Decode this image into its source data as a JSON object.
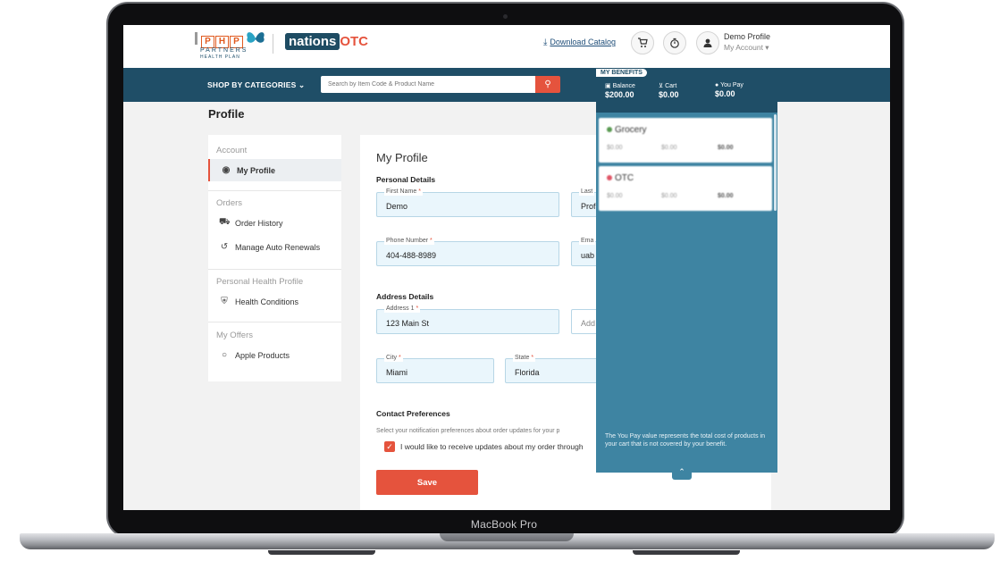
{
  "device": {
    "label": "MacBook Pro"
  },
  "header": {
    "brand_letters": [
      "P",
      "H",
      "P"
    ],
    "brand_line1": "PARTNERS",
    "brand_line2": "HEALTH PLAN",
    "partner_logo_a": "nations",
    "partner_logo_b": "OTC",
    "download_link": "Download Catalog",
    "profile_name": "Demo Profile",
    "profile_sub": "My Account ▾",
    "icons": [
      "download-icon",
      "cart-icon",
      "timer-icon",
      "user-icon"
    ]
  },
  "navbar": {
    "shop_label": "SHOP BY CATEGORIES ⌄",
    "search_placeholder": "Search by Item Code & Product Name"
  },
  "page": {
    "title": "Profile"
  },
  "sidebar": {
    "sections": [
      {
        "title": "Account",
        "items": [
          {
            "label": "My Profile",
            "icon": "user-circle-icon",
            "active": true
          }
        ]
      },
      {
        "title": "Orders",
        "items": [
          {
            "label": "Order History",
            "icon": "truck-icon"
          },
          {
            "label": "Manage Auto Renewals",
            "icon": "history-icon"
          }
        ]
      },
      {
        "title": "Personal Health Profile",
        "items": [
          {
            "label": "Health Conditions",
            "icon": "shield-icon"
          }
        ]
      },
      {
        "title": "My Offers",
        "items": [
          {
            "label": "Apple Products",
            "icon": "apple-icon"
          }
        ]
      }
    ]
  },
  "profile": {
    "heading": "My Profile",
    "personal_title": "Personal Details",
    "first_name_label": "First Name",
    "first_name": "Demo",
    "last_name_label": "Last",
    "last_name": "Prof",
    "phone_label": "Phone Number",
    "phone": "404-488-8989",
    "email_label": "Ema",
    "email": "uab",
    "address_title": "Address Details",
    "address1_label": "Address 1",
    "address1": "123 Main St",
    "address2_placeholder": "Add",
    "city_label": "City",
    "city": "Miami",
    "state_label": "State",
    "state": "Florida",
    "contact_title": "Contact Preferences",
    "contact_note": "Select your notification preferences about order updates for your p",
    "checkbox_label": "I would like to receive updates about my order through",
    "checkbox_checked": true,
    "save_label": "Save",
    "required_mark": "*"
  },
  "benefits": {
    "tag": "MY BENEFITS",
    "balance_label": "Balance",
    "balance": "$200.00",
    "cart_label": "Cart",
    "cart": "$0.00",
    "you_pay_label": "You Pay",
    "you_pay": "$0.00",
    "cards": [
      {
        "name": "Grocery",
        "dot_color": "#5a9a52",
        "balance": "$0.00",
        "cart": "$0.00",
        "you_pay": "$0.00"
      },
      {
        "name": "OTC",
        "dot_color": "#e05566",
        "balance": "$0.00",
        "cart": "$0.00",
        "you_pay": "$0.00"
      }
    ],
    "footnote": "The You Pay value represents the total cost of products in your cart that is not covered by your benefit.",
    "collapse_icon": "chevron-up-icon"
  },
  "colors": {
    "primary": "#1f4e67",
    "accent": "#e5533d",
    "panel": "#3e84a2",
    "field_bg": "#eaf6fc"
  }
}
